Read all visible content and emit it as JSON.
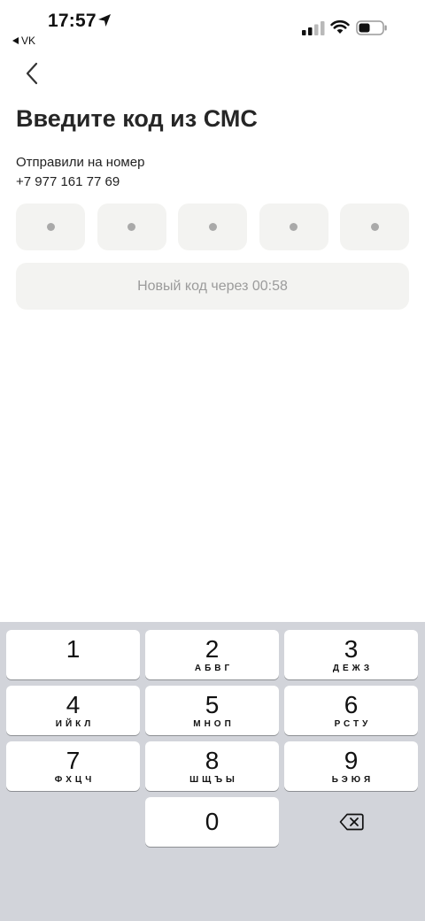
{
  "status_bar": {
    "time": "17:57",
    "back_app": "VK",
    "icons": [
      "location-arrow-icon",
      "signal-icon",
      "wifi-icon",
      "battery-icon"
    ]
  },
  "header": {
    "back_icon": "chevron-left-icon",
    "title": "Введите код из СМС"
  },
  "info": {
    "sent_label": "Отправили на номер",
    "phone": "+7 977 161 77 69"
  },
  "code_input": {
    "length": 5
  },
  "resend": {
    "label": "Новый код через 00:58"
  },
  "keyboard": {
    "keys": [
      {
        "digit": "1",
        "letters": ""
      },
      {
        "digit": "2",
        "letters": "АБВГ"
      },
      {
        "digit": "3",
        "letters": "ДЕЖЗ"
      },
      {
        "digit": "4",
        "letters": "ИЙКЛ"
      },
      {
        "digit": "5",
        "letters": "МНОП"
      },
      {
        "digit": "6",
        "letters": "РСТУ"
      },
      {
        "digit": "7",
        "letters": "ФХЦЧ"
      },
      {
        "digit": "8",
        "letters": "ШЩЪЫ"
      },
      {
        "digit": "9",
        "letters": "ЬЭЮЯ"
      },
      {
        "digit": "0",
        "letters": ""
      }
    ],
    "delete_icon": "backspace-icon"
  },
  "colors": {
    "cell_bg": "#f3f3f1",
    "placeholder_dot": "#a9a9a9",
    "keyboard_bg": "#d2d4da",
    "disabled_text": "#9b9b9b"
  }
}
